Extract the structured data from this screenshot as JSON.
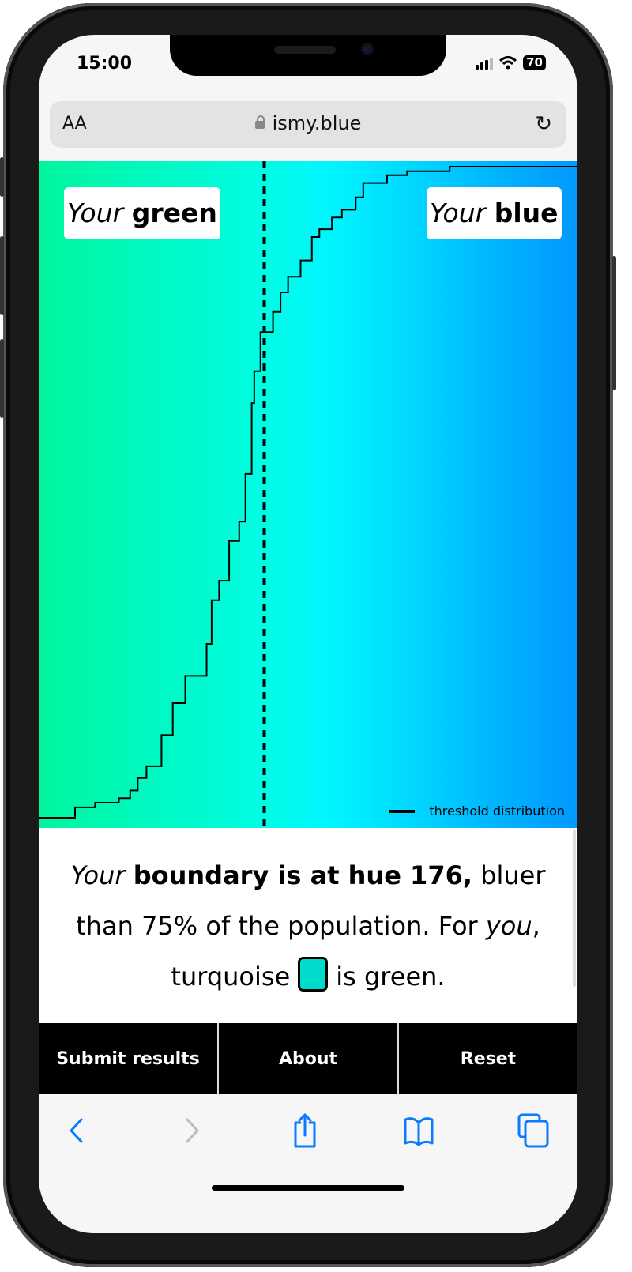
{
  "status_bar": {
    "time": "15:00",
    "battery": "70"
  },
  "browser": {
    "text_size_label": "AA",
    "url": "ismy.blue",
    "icons": [
      "lock-icon",
      "reload-icon"
    ]
  },
  "chart_data": {
    "type": "line",
    "step": true,
    "xlabel": "",
    "ylabel": "",
    "xlim": [
      158,
      201
    ],
    "ylim": [
      0,
      1
    ],
    "grid": false,
    "legend_position": "bottom-right",
    "series": [
      {
        "name": "threshold distribution",
        "color": "#000000",
        "x": [
          158,
          160.9,
          162.5,
          164.4,
          165.3,
          165.9,
          166.6,
          167.8,
          168.7,
          169.7,
          171.4,
          171.8,
          172.4,
          173.2,
          174.0,
          174.5,
          175.0,
          175.2,
          175.7,
          176.7,
          177.3,
          177.9,
          178.9,
          179.8,
          180.4,
          181.4,
          182.2,
          183.3,
          183.9,
          185.8,
          187.4,
          190.8,
          201
        ],
        "y": [
          0,
          0.016,
          0.023,
          0.03,
          0.042,
          0.061,
          0.079,
          0.127,
          0.176,
          0.218,
          0.267,
          0.334,
          0.364,
          0.425,
          0.455,
          0.528,
          0.637,
          0.686,
          0.746,
          0.777,
          0.807,
          0.831,
          0.856,
          0.892,
          0.904,
          0.922,
          0.934,
          0.953,
          0.975,
          0.987,
          0.993,
          1.0,
          1.0
        ]
      }
    ],
    "marker_line": {
      "x": 176,
      "style": "dashed",
      "color": "#000000"
    },
    "annotations": {
      "left_label": {
        "italic": "Your",
        "bold": "green"
      },
      "right_label": {
        "italic": "Your",
        "bold": "blue"
      }
    },
    "background_gradient": [
      "#00f59c",
      "#00f6ff",
      "#0098ff"
    ]
  },
  "result": {
    "your": "Your",
    "bold": "boundary is at hue 176,",
    "part1": " bluer than 75% of the population. For ",
    "you": "you",
    "part2": ", turquoise",
    "part3": "is green.",
    "swatch_color": "#00dccb"
  },
  "actions": {
    "submit": "Submit results",
    "about": "About",
    "reset": "Reset"
  },
  "toolbar": {
    "icons": [
      "back-icon",
      "forward-icon",
      "share-icon",
      "bookmarks-icon",
      "tabs-icon"
    ],
    "accent": "#0a7aff"
  }
}
